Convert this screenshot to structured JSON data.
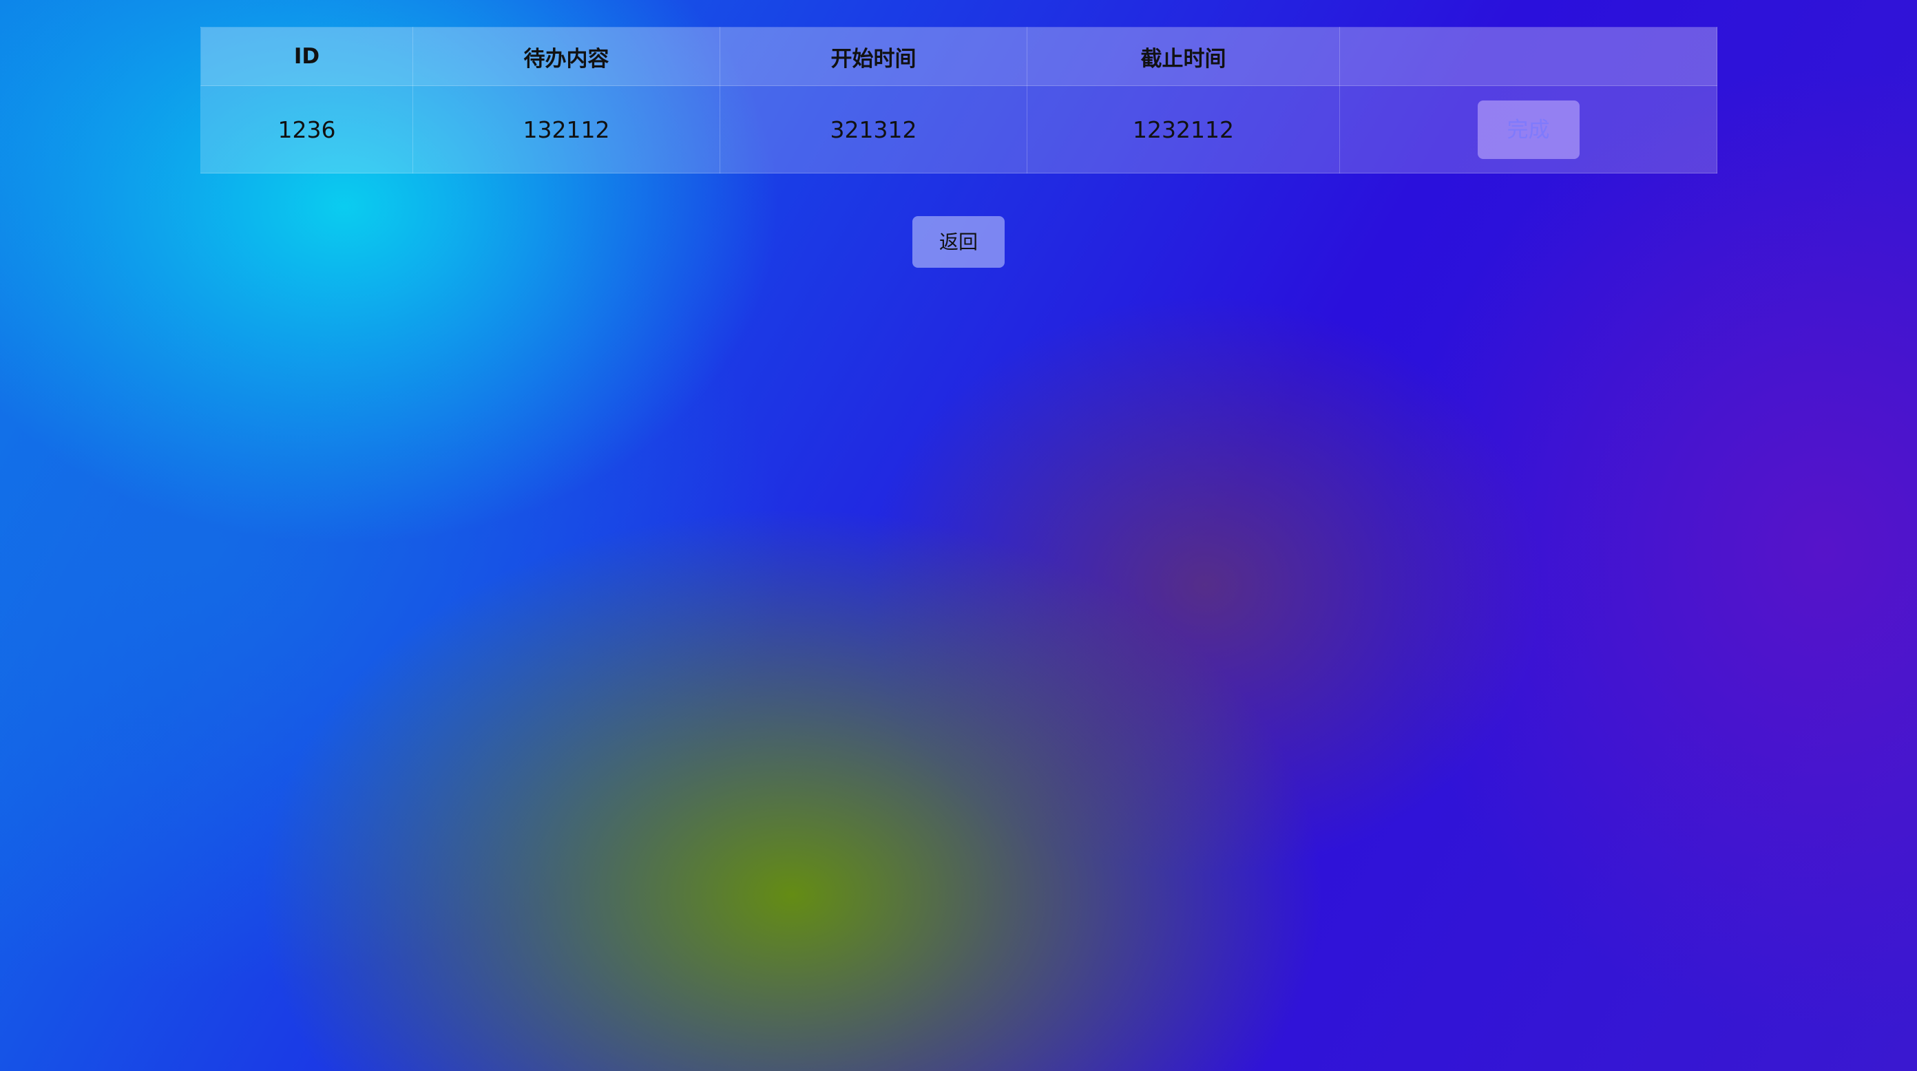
{
  "table": {
    "headers": [
      "ID",
      "待办内容",
      "开始时间",
      "截止时间",
      ""
    ],
    "rows": [
      {
        "id": "1236",
        "content": "132112",
        "start": "321312",
        "end": "1232112",
        "action_label": "完成"
      }
    ]
  },
  "back_button": {
    "label": "返回"
  }
}
